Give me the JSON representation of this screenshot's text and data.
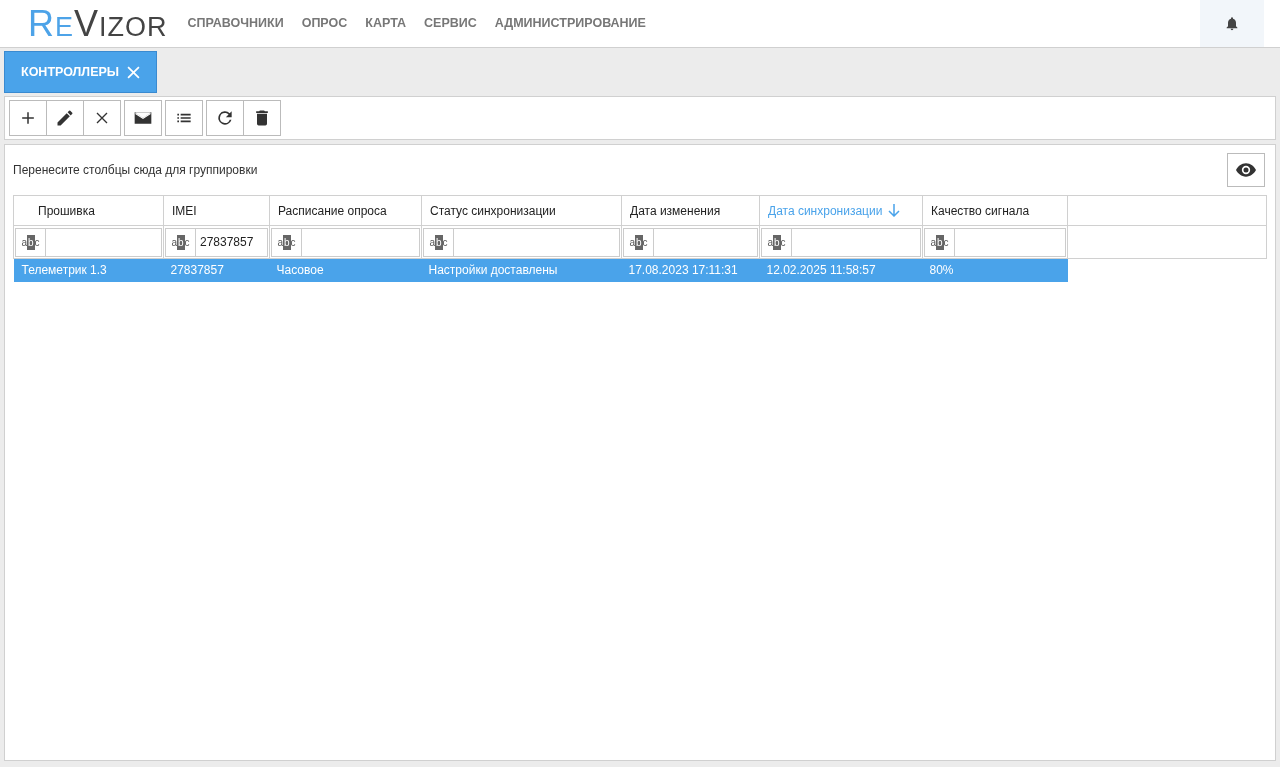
{
  "logo": {
    "accent": "RE",
    "rest": "VIZOR"
  },
  "menu": [
    "СПРАВОЧНИКИ",
    "ОПРОС",
    "КАРТА",
    "СЕРВИС",
    "АДМИНИСТРИРОВАНИЕ"
  ],
  "tabs": [
    {
      "label": "КОНТРОЛЛЕРЫ",
      "selected": true
    }
  ],
  "toolbar": [
    [
      {
        "kind": "plus"
      },
      {
        "kind": "pencil"
      },
      {
        "kind": "cross"
      }
    ],
    [
      {
        "kind": "mail"
      }
    ],
    [
      {
        "kind": "list"
      }
    ],
    [
      {
        "kind": "refresh"
      },
      {
        "kind": "trash"
      }
    ]
  ],
  "group_panel": {
    "hint": "Перенесите столбцы сюда для группировки"
  },
  "table": {
    "columns": [
      {
        "title": "Прошивка",
        "sorted": false,
        "filter_type": "abc"
      },
      {
        "title": "IMEI",
        "sorted": false,
        "filter_type": "abc",
        "filter": "27837857"
      },
      {
        "title": "Расписание опроса",
        "sorted": false,
        "filter_type": "abc"
      },
      {
        "title": "Статус синхронизации",
        "sorted": false,
        "filter_type": "abc"
      },
      {
        "title": "Дата изменения",
        "sorted": false,
        "filter_type": "abc"
      },
      {
        "title": "Дата синхронизации",
        "sorted": true,
        "filter_type": "abc"
      },
      {
        "title": "Качество сигнала",
        "sorted": false,
        "filter_type": "abc"
      }
    ],
    "rows": [
      {
        "selected": true,
        "cells": [
          "Телеметрик 1.3",
          "27837857",
          "Часовое",
          "Настройки доставлены",
          "17.08.2023 17:11:31",
          "12.02.2025 11:58:57",
          "80%"
        ]
      }
    ]
  }
}
